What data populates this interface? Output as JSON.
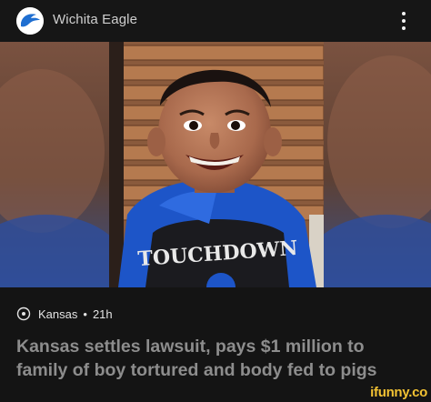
{
  "header": {
    "publisher": "Wichita Eagle",
    "avatar_icon": "eagle-logo-icon",
    "more_icon": "more-vertical-icon"
  },
  "photo": {
    "shirt_text": "TOUCHDOWN"
  },
  "meta": {
    "location_icon": "location-pin-icon",
    "location": "Kansas",
    "separator": "•",
    "age": "21h"
  },
  "headline": "Kansas settles lawsuit, pays $1 million to family of boy tortured and body fed to pigs",
  "watermark": "ifunny.co",
  "colors": {
    "background": "#141414",
    "headline_text": "#8d8d8d",
    "watermark": "#f2c233",
    "brand_blue": "#1f6fd1"
  }
}
